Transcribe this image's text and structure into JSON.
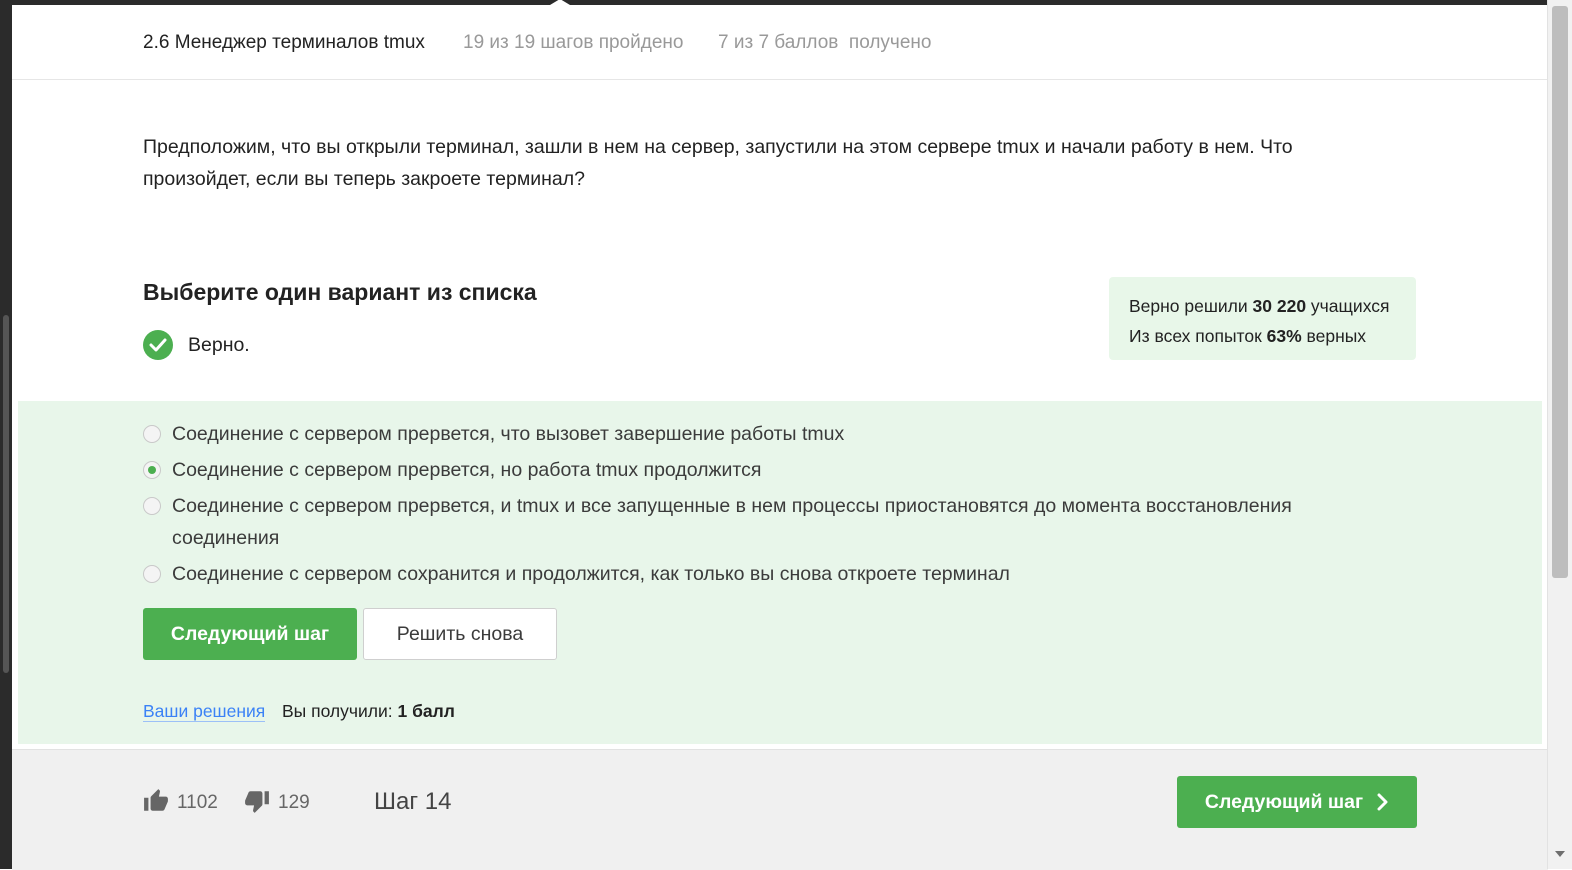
{
  "header": {
    "lesson_title": "2.6 Менеджер терминалов tmux",
    "steps_progress": "19 из 19 шагов пройдено",
    "points_progress": "7 из 7 баллов  получено"
  },
  "question": {
    "text": "Предположим, что вы открыли терминал, зашли в нем на сервер, запустили на этом сервере tmux и начали работу в нем. Что произойдет, если вы теперь закроете терминал?",
    "choose_heading": "Выберите один вариант из списка",
    "result_label": "Верно."
  },
  "stats": {
    "solved_prefix": "Верно решили ",
    "solved_count": "30 220",
    "solved_suffix": " учащихся",
    "attempts_prefix": "Из всех попыток ",
    "attempts_percent": "63%",
    "attempts_suffix": " верных"
  },
  "options": [
    {
      "label": "Соединение с сервером прервется, что вызовет завершение работы tmux",
      "selected": false
    },
    {
      "label": "Соединение с сервером прервется, но работа tmux продолжится",
      "selected": true
    },
    {
      "label": "Соединение с сервером прервется, и tmux и все запущенные в нем процессы приостановятся до момента восстановления соединения",
      "selected": false
    },
    {
      "label": "Соединение с сервером сохранится и продолжится, как только вы снова откроете терминал",
      "selected": false
    }
  ],
  "actions": {
    "next_step": "Следующий шаг",
    "retry": "Решить снова",
    "your_solutions": "Ваши решения",
    "score_prefix": "Вы получили: ",
    "score_value": "1 балл"
  },
  "footer": {
    "likes": "1102",
    "dislikes": "129",
    "step_label": "Шаг 14",
    "next_step": "Следующий шаг"
  },
  "colors": {
    "accent_green": "#4caf50",
    "answer_area_bg": "#e8f6ea",
    "stats_bg": "#e8f7e9",
    "link_blue": "#3b82f6"
  }
}
